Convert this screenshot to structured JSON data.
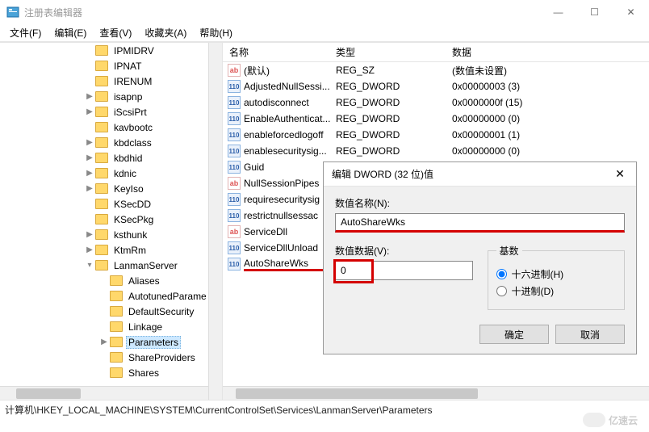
{
  "window": {
    "title": "注册表编辑器",
    "min": "—",
    "max": "☐",
    "close": "✕"
  },
  "menus": [
    "文件(F)",
    "编辑(E)",
    "查看(V)",
    "收藏夹(A)",
    "帮助(H)"
  ],
  "tree": [
    {
      "indent": 104,
      "exp": "",
      "label": "IPMIDRV"
    },
    {
      "indent": 104,
      "exp": "",
      "label": "IPNAT"
    },
    {
      "indent": 104,
      "exp": "",
      "label": "IRENUM"
    },
    {
      "indent": 104,
      "exp": ">",
      "label": "isapnp"
    },
    {
      "indent": 104,
      "exp": ">",
      "label": "iScsiPrt"
    },
    {
      "indent": 104,
      "exp": "",
      "label": "kavbootc"
    },
    {
      "indent": 104,
      "exp": ">",
      "label": "kbdclass"
    },
    {
      "indent": 104,
      "exp": ">",
      "label": "kbdhid"
    },
    {
      "indent": 104,
      "exp": ">",
      "label": "kdnic"
    },
    {
      "indent": 104,
      "exp": ">",
      "label": "KeyIso"
    },
    {
      "indent": 104,
      "exp": "",
      "label": "KSecDD"
    },
    {
      "indent": 104,
      "exp": "",
      "label": "KSecPkg"
    },
    {
      "indent": 104,
      "exp": ">",
      "label": "ksthunk"
    },
    {
      "indent": 104,
      "exp": ">",
      "label": "KtmRm"
    },
    {
      "indent": 104,
      "exp": "v",
      "label": "LanmanServer"
    },
    {
      "indent": 122,
      "exp": "",
      "label": "Aliases"
    },
    {
      "indent": 122,
      "exp": "",
      "label": "AutotunedParame"
    },
    {
      "indent": 122,
      "exp": "",
      "label": "DefaultSecurity"
    },
    {
      "indent": 122,
      "exp": "",
      "label": "Linkage"
    },
    {
      "indent": 122,
      "exp": ">",
      "label": "Parameters",
      "selected": true
    },
    {
      "indent": 122,
      "exp": "",
      "label": "ShareProviders"
    },
    {
      "indent": 122,
      "exp": "",
      "label": "Shares"
    }
  ],
  "list": {
    "cols": {
      "name": "名称",
      "type": "类型",
      "data": "数据"
    },
    "rows": [
      {
        "ico": "str",
        "name": "(默认)",
        "type": "REG_SZ",
        "data": "(数值未设置)"
      },
      {
        "ico": "dw",
        "name": "AdjustedNullSessi...",
        "type": "REG_DWORD",
        "data": "0x00000003 (3)"
      },
      {
        "ico": "dw",
        "name": "autodisconnect",
        "type": "REG_DWORD",
        "data": "0x0000000f (15)"
      },
      {
        "ico": "dw",
        "name": "EnableAuthenticat...",
        "type": "REG_DWORD",
        "data": "0x00000000 (0)"
      },
      {
        "ico": "dw",
        "name": "enableforcedlogoff",
        "type": "REG_DWORD",
        "data": "0x00000001 (1)"
      },
      {
        "ico": "dw",
        "name": "enablesecuritysig...",
        "type": "REG_DWORD",
        "data": "0x00000000 (0)"
      },
      {
        "ico": "dw",
        "name": "Guid",
        "type": "",
        "data": ""
      },
      {
        "ico": "str",
        "name": "NullSessionPipes",
        "type": "",
        "data": ""
      },
      {
        "ico": "dw",
        "name": "requiresecuritysig",
        "type": "",
        "data": ""
      },
      {
        "ico": "dw",
        "name": "restrictnullsessac",
        "type": "",
        "data": ""
      },
      {
        "ico": "str",
        "name": "ServiceDll",
        "type": "",
        "data": ""
      },
      {
        "ico": "dw",
        "name": "ServiceDllUnload",
        "type": "",
        "data": ""
      },
      {
        "ico": "dw",
        "name": "AutoShareWks",
        "type": "",
        "data": "",
        "hl": true
      }
    ]
  },
  "dialog": {
    "title": "编辑 DWORD (32 位)值",
    "name_label": "数值名称(N):",
    "name_value": "AutoShareWks",
    "data_label": "数值数据(V):",
    "data_value": "0",
    "base_legend": "基数",
    "hex_label": "十六进制(H)",
    "dec_label": "十进制(D)",
    "ok": "确定",
    "cancel": "取消"
  },
  "overflow": "64",
  "status": "计算机\\HKEY_LOCAL_MACHINE\\SYSTEM\\CurrentControlSet\\Services\\LanmanServer\\Parameters",
  "watermark": "亿速云"
}
